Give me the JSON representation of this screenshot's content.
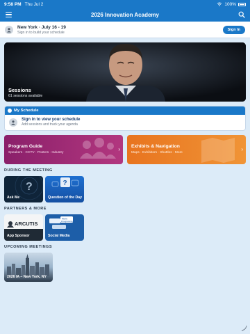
{
  "status_bar": {
    "time": "9:58 PM",
    "date": "Thu Jul 2",
    "battery": "100%"
  },
  "navbar": {
    "title": "2026 Innovation Academy"
  },
  "signin_bar": {
    "location": "New York · July 16 - 19",
    "subtitle": "Sign in to build your schedule",
    "button": "Sign In"
  },
  "hero": {
    "title": "Sessions",
    "subtitle": "61 sessions available"
  },
  "schedule": {
    "header": "My Schedule",
    "title": "Sign in to view your schedule",
    "subtitle": "Add sessions and track your agenda"
  },
  "program_guide": {
    "title": "Program Guide",
    "subtitle": "Speakers · CCTV · Posters · Industry"
  },
  "exhibits": {
    "title": "Exhibits & Navigation",
    "subtitle": "Maps · Exhibitors · Shuttles · More"
  },
  "sections": {
    "during": "DURING THE MEETING",
    "partners": "PARTNERS & MORE",
    "upcoming": "UPCOMING MEETINGS"
  },
  "cards": {
    "ask_me": "Ask Me",
    "qotd": "Question of the Day",
    "sponsor": "App Sponsor",
    "sponsor_logo": "ARCUTIS",
    "social": "Social Media",
    "social_bubble1": "We're",
    "social_bubble2": "#ImagineHope",
    "meeting": "2026 IA – New York, NY"
  },
  "colors": {
    "primary": "#1a78c8",
    "guide": "#9b2a73",
    "exhibits": "#ec8128",
    "background": "#dcebf8"
  },
  "icons": {
    "menu": "hamburger-menu-icon",
    "search": "search-icon",
    "person": "person-icon",
    "chevron": "chevron-right-icon"
  }
}
